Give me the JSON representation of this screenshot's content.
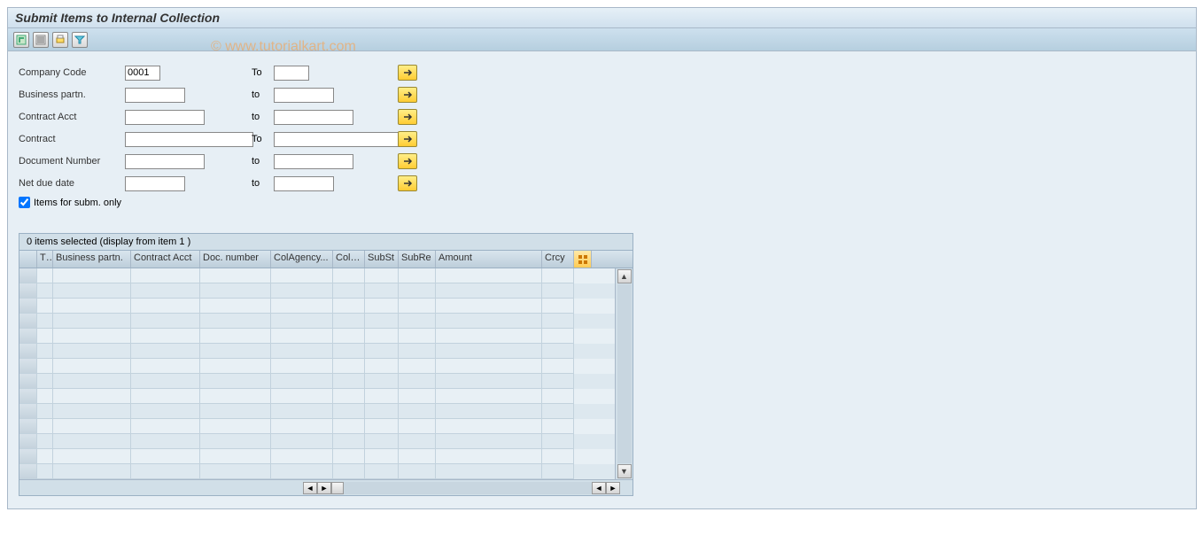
{
  "title": "Submit Items to Internal Collection",
  "watermark": "© www.tutorialkart.com",
  "form": {
    "company_code_label": "Company Code",
    "company_code_value": "0001",
    "to_label_cap": "To",
    "to_label": "to",
    "business_partn_label": "Business partn.",
    "contract_acct_label": "Contract Acct",
    "contract_label": "Contract",
    "doc_number_label": "Document Number",
    "net_due_label": "Net due date",
    "items_subm_label": "Items for subm. only"
  },
  "grid": {
    "status": "0 items selected (display from item 1 )",
    "headers": {
      "tx": "Tx",
      "bp": "Business partn.",
      "ca": "Contract Acct",
      "dn": "Doc. number",
      "cag": "ColAgency...",
      "ci": "ColItm",
      "ss": "SubSt",
      "sr": "SubRe",
      "am": "Amount",
      "cr": "Crcy"
    },
    "num_rows": 14
  }
}
